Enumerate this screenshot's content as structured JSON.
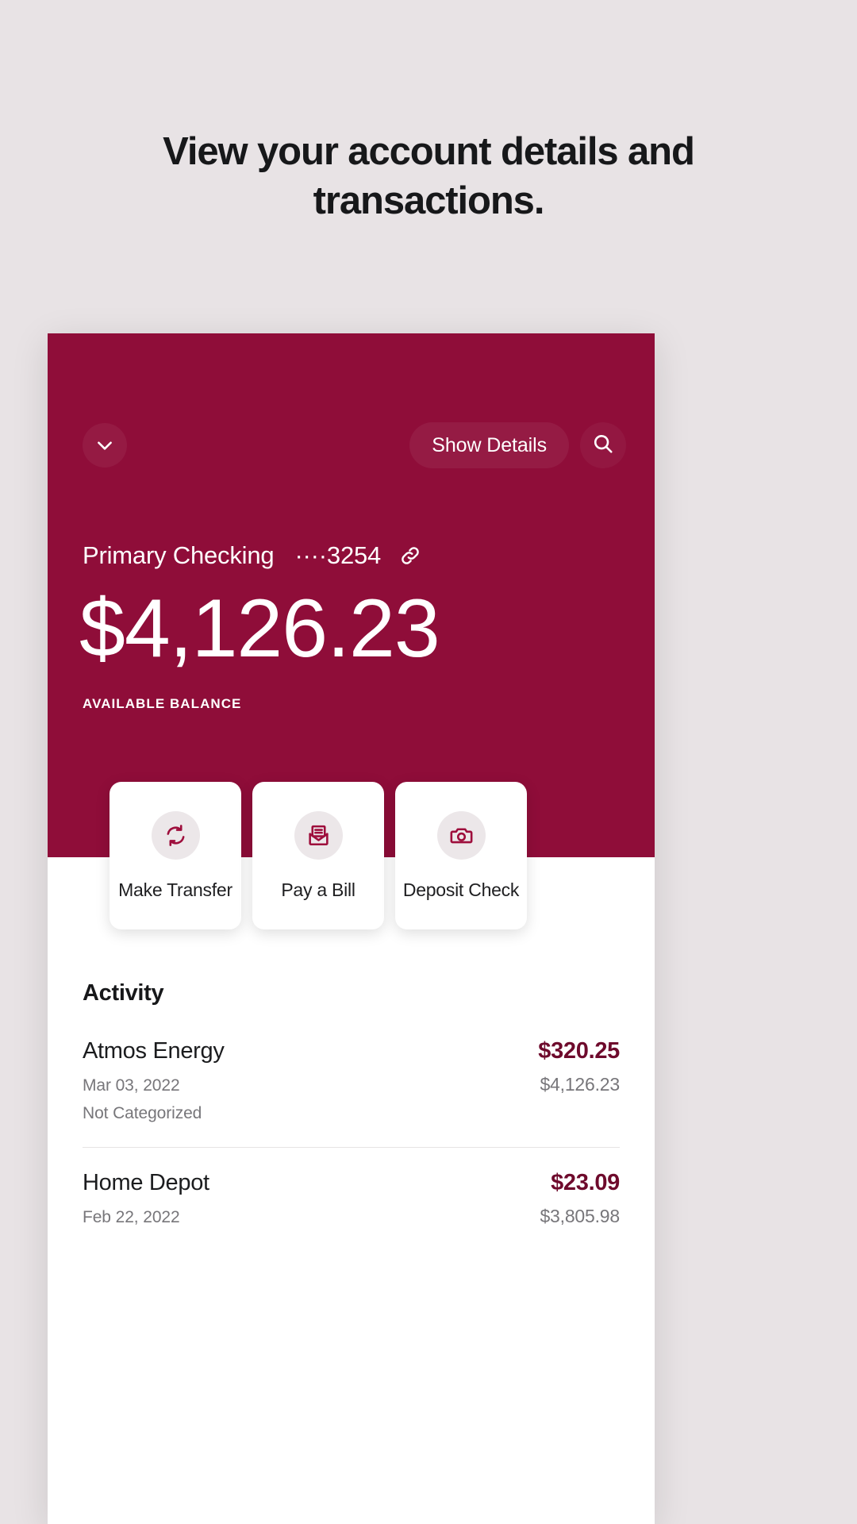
{
  "headline": "View your account details and transactions.",
  "colors": {
    "background": "#E8E3E5",
    "brand_maroon": "#8F0D39",
    "amount_maroon": "#6E0A2C",
    "card_white": "#FFFFFF"
  },
  "hero": {
    "collapse_icon": "chevron-down-icon",
    "show_details_label": "Show Details",
    "search_icon": "search-icon",
    "account_name": "Primary Checking",
    "account_mask": "····3254",
    "link_icon": "link-icon",
    "balance": "$4,126.23",
    "balance_label": "AVAILABLE BALANCE"
  },
  "actions": [
    {
      "label": "Make Transfer",
      "icon": "transfer-arrows-icon"
    },
    {
      "label": "Pay a Bill",
      "icon": "envelope-bill-icon"
    },
    {
      "label": "Deposit Check",
      "icon": "camera-icon"
    }
  ],
  "activity": {
    "title": "Activity",
    "transactions": [
      {
        "merchant": "Atmos Energy",
        "amount": "$320.25",
        "date": "Mar 03, 2022",
        "running_balance": "$4,126.23",
        "category": "Not Categorized"
      },
      {
        "merchant": "Home Depot",
        "amount": "$23.09",
        "date": "Feb 22, 2022",
        "running_balance": "$3,805.98",
        "category": ""
      }
    ]
  }
}
